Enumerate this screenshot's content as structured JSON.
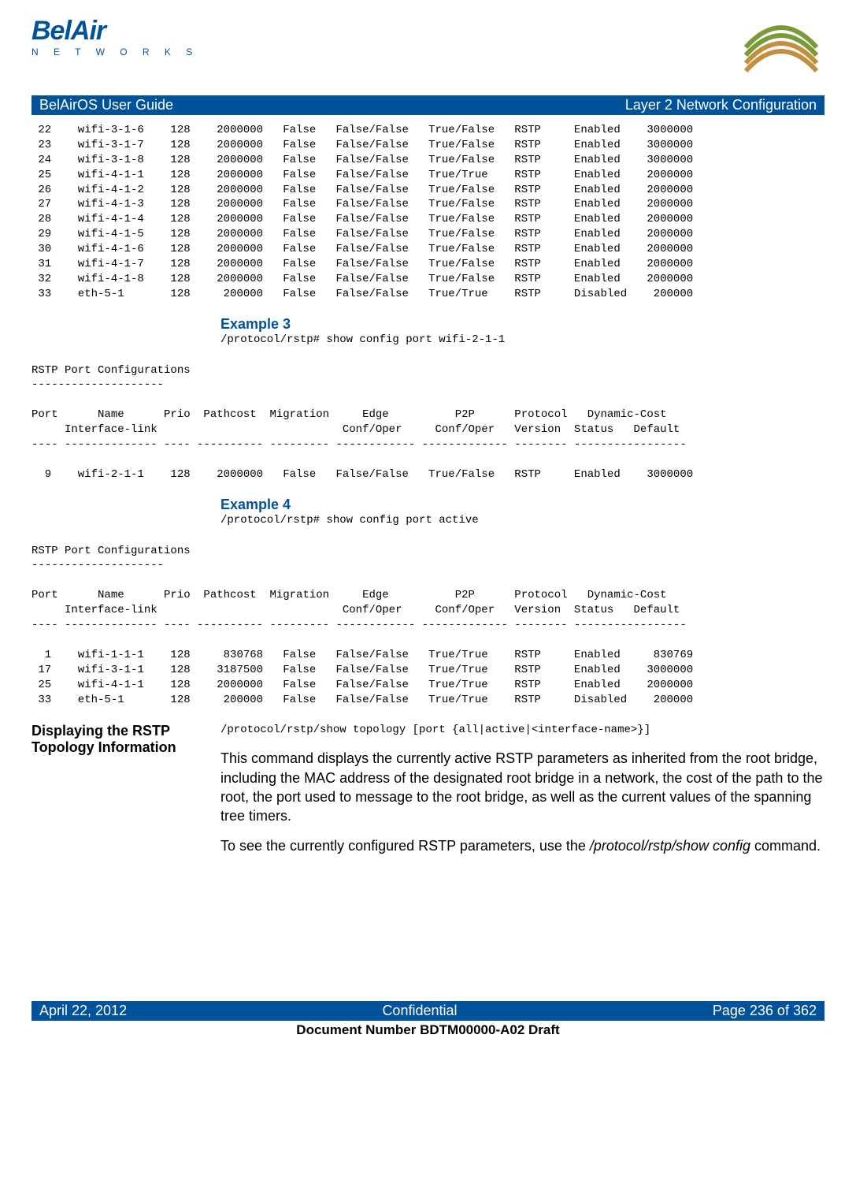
{
  "logo": {
    "brand_top": "BelAir",
    "brand_bottom": "N E T W O R K S"
  },
  "header_bar": {
    "left": "BelAirOS User Guide",
    "right": "Layer 2 Network Configuration"
  },
  "table1": " 22    wifi-3-1-6    128    2000000   False   False/False   True/False   RSTP     Enabled    3000000\n 23    wifi-3-1-7    128    2000000   False   False/False   True/False   RSTP     Enabled    3000000\n 24    wifi-3-1-8    128    2000000   False   False/False   True/False   RSTP     Enabled    3000000\n 25    wifi-4-1-1    128    2000000   False   False/False   True/True    RSTP     Enabled    2000000\n 26    wifi-4-1-2    128    2000000   False   False/False   True/False   RSTP     Enabled    2000000\n 27    wifi-4-1-3    128    2000000   False   False/False   True/False   RSTP     Enabled    2000000\n 28    wifi-4-1-4    128    2000000   False   False/False   True/False   RSTP     Enabled    2000000\n 29    wifi-4-1-5    128    2000000   False   False/False   True/False   RSTP     Enabled    2000000\n 30    wifi-4-1-6    128    2000000   False   False/False   True/False   RSTP     Enabled    2000000\n 31    wifi-4-1-7    128    2000000   False   False/False   True/False   RSTP     Enabled    2000000\n 32    wifi-4-1-8    128    2000000   False   False/False   True/False   RSTP     Enabled    2000000\n 33    eth-5-1       128     200000   False   False/False   True/True    RSTP     Disabled    200000",
  "example3": {
    "heading": "Example 3",
    "cmd": "/protocol/rstp# show config port wifi-2-1-1"
  },
  "table2": "RSTP Port Configurations\n--------------------\n\nPort      Name      Prio  Pathcost  Migration     Edge          P2P      Protocol   Dynamic-Cost\n     Interface-link                            Conf/Oper     Conf/Oper   Version  Status   Default\n---- -------------- ---- ---------- --------- ------------ ------------- -------- -----------------\n\n  9    wifi-2-1-1    128    2000000   False   False/False   True/False   RSTP     Enabled    3000000",
  "example4": {
    "heading": "Example 4",
    "cmd": "/protocol/rstp# show config port active"
  },
  "table3": "RSTP Port Configurations\n--------------------\n\nPort      Name      Prio  Pathcost  Migration     Edge          P2P      Protocol   Dynamic-Cost\n     Interface-link                            Conf/Oper     Conf/Oper   Version  Status   Default\n---- -------------- ---- ---------- --------- ------------ ------------- -------- -----------------\n\n  1    wifi-1-1-1    128     830768   False   False/False   True/True    RSTP     Enabled     830769\n 17    wifi-3-1-1    128    3187500   False   False/False   True/True    RSTP     Enabled    3000000\n 25    wifi-4-1-1    128    2000000   False   False/False   True/True    RSTP     Enabled    2000000\n 33    eth-5-1       128     200000   False   False/False   True/True    RSTP     Disabled    200000",
  "section": {
    "label": "Displaying the RSTP Topology Information",
    "syntax": "/protocol/rstp/show topology [port {all|active|<interface-name>}]",
    "para1": "This command displays the currently active RSTP parameters as inherited from the root bridge, including the MAC address of the designated root bridge in a network, the cost of the path to the root, the port used to message to the root bridge, as well as the current values of the spanning tree timers.",
    "para2a": "To see the currently configured RSTP parameters, use the ",
    "para2b": "/protocol/rstp/show config",
    "para2c": " command."
  },
  "footer": {
    "left": "April 22, 2012",
    "center": "Confidential",
    "right": "Page 236 of 362",
    "docnum": "Document Number BDTM00000-A02 Draft"
  }
}
